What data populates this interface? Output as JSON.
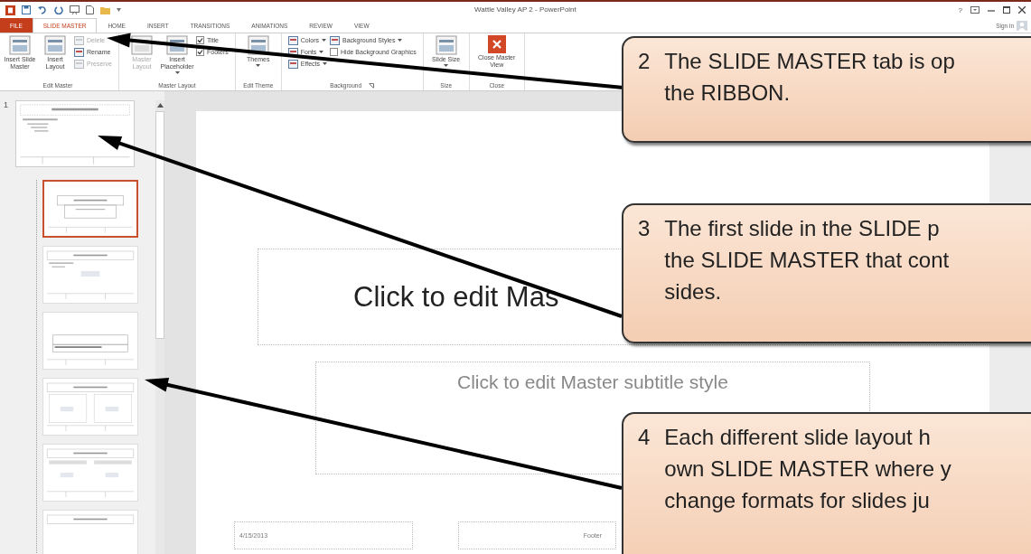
{
  "window": {
    "title": "Wattle Valley AP 2 - PowerPoint",
    "help": "?",
    "sign_in": "Sign in"
  },
  "tabs": [
    {
      "label": "FILE",
      "kind": "file",
      "selected": false
    },
    {
      "label": "SLIDE MASTER",
      "kind": "tab",
      "selected": true
    },
    {
      "label": "HOME",
      "kind": "tab",
      "selected": false
    },
    {
      "label": "INSERT",
      "kind": "tab",
      "selected": false
    },
    {
      "label": "TRANSITIONS",
      "kind": "tab",
      "selected": false
    },
    {
      "label": "ANIMATIONS",
      "kind": "tab",
      "selected": false
    },
    {
      "label": "REVIEW",
      "kind": "tab",
      "selected": false
    },
    {
      "label": "VIEW",
      "kind": "tab",
      "selected": false
    }
  ],
  "ribbon": {
    "groups": [
      {
        "label": "Edit Master",
        "launcher": false,
        "columns": [
          [
            {
              "kind": "large",
              "label": "Insert Slide Master",
              "disabled": false,
              "menu": false
            }
          ],
          [
            {
              "kind": "large",
              "label": "Insert Layout",
              "disabled": false,
              "menu": false
            }
          ],
          [
            {
              "kind": "small",
              "label": "Delete",
              "disabled": true,
              "menu": false
            },
            {
              "kind": "small",
              "label": "Rename",
              "disabled": false,
              "menu": false
            },
            {
              "kind": "small",
              "label": "Preserve",
              "disabled": true,
              "menu": false
            }
          ]
        ]
      },
      {
        "label": "Master Layout",
        "launcher": false,
        "columns": [
          [
            {
              "kind": "large",
              "label": "Master Layout",
              "disabled": true,
              "menu": false
            }
          ],
          [
            {
              "kind": "large",
              "label": "Insert Placeholder",
              "disabled": false,
              "menu": true
            }
          ],
          [
            {
              "kind": "check",
              "label": "Title",
              "checked": true,
              "disabled": false
            },
            {
              "kind": "check",
              "label": "Footers",
              "checked": true,
              "disabled": false
            }
          ]
        ]
      },
      {
        "label": "Edit Theme",
        "launcher": false,
        "columns": [
          [
            {
              "kind": "large",
              "label": "Themes",
              "disabled": false,
              "menu": true
            }
          ]
        ]
      },
      {
        "label": "Background",
        "launcher": true,
        "columns": [
          [
            {
              "kind": "small",
              "label": "Colors",
              "disabled": false,
              "menu": true
            },
            {
              "kind": "small",
              "label": "Fonts",
              "disabled": false,
              "menu": true
            },
            {
              "kind": "small",
              "label": "Effects",
              "disabled": false,
              "menu": true
            }
          ],
          [
            {
              "kind": "small",
              "label": "Background Styles",
              "disabled": false,
              "menu": true
            },
            {
              "kind": "check",
              "label": "Hide Background Graphics",
              "checked": false,
              "disabled": false
            }
          ]
        ]
      },
      {
        "label": "Size",
        "launcher": false,
        "columns": [
          [
            {
              "kind": "large",
              "label": "Slide Size",
              "disabled": false,
              "menu": true
            }
          ]
        ]
      },
      {
        "label": "Close",
        "launcher": false,
        "columns": [
          [
            {
              "kind": "close",
              "label": "Close Master View"
            }
          ]
        ]
      }
    ]
  },
  "thumbnails": {
    "master": {
      "number": "1",
      "selected": false
    },
    "layouts": [
      {
        "kind": "title",
        "selected": true
      },
      {
        "kind": "content",
        "selected": false
      },
      {
        "kind": "section",
        "selected": false
      },
      {
        "kind": "two",
        "selected": false
      },
      {
        "kind": "comparison",
        "selected": false
      },
      {
        "kind": "titleonly",
        "selected": false
      }
    ]
  },
  "slide": {
    "title": "Click to edit Mas",
    "subtitle": "Click to edit Master subtitle style",
    "date": "4/15/2013",
    "footer": "Footer"
  },
  "callouts": [
    {
      "number": "2",
      "lines": [
        "The SLIDE MASTER tab is op",
        "the RIBBON."
      ]
    },
    {
      "number": "3",
      "lines": [
        "The first slide in the SLIDE p",
        "the SLIDE MASTER that cont",
        "sides."
      ]
    },
    {
      "number": "4",
      "lines": [
        "Each different slide layout h",
        "own SLIDE MASTER where y",
        "change formats for slides ju"
      ]
    }
  ]
}
